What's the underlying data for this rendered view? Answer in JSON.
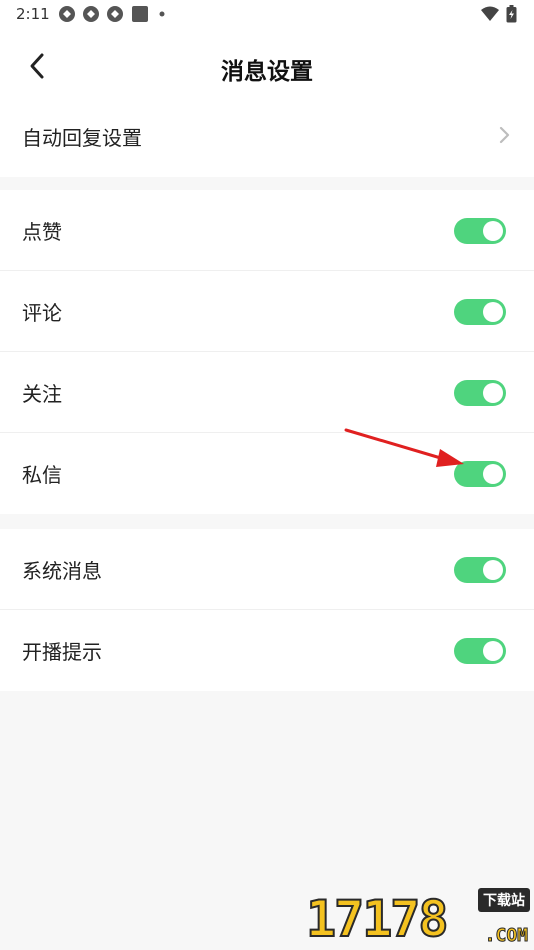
{
  "status_bar": {
    "time": "2:11",
    "left_icons": [
      "sync-icon",
      "sync-icon",
      "sync-icon",
      "square-icon",
      "dot-icon"
    ],
    "right_icons": [
      "wifi-icon",
      "battery-icon"
    ]
  },
  "header": {
    "title": "消息设置",
    "back_icon": "chevron-left-icon"
  },
  "sections": [
    {
      "rows": [
        {
          "label": "自动回复设置",
          "control": "chevron"
        }
      ]
    },
    {
      "rows": [
        {
          "label": "点赞",
          "control": "toggle",
          "on": true
        },
        {
          "label": "评论",
          "control": "toggle",
          "on": true
        },
        {
          "label": "关注",
          "control": "toggle",
          "on": true
        },
        {
          "label": "私信",
          "control": "toggle",
          "on": true
        }
      ]
    },
    {
      "rows": [
        {
          "label": "系统消息",
          "control": "toggle",
          "on": true
        },
        {
          "label": "开播提示",
          "control": "toggle",
          "on": true
        }
      ]
    }
  ],
  "colors": {
    "toggle_on": "#4fd47e",
    "annotation_arrow": "#e02020",
    "background": "#f7f7f7"
  },
  "watermark": {
    "number": "17178",
    "badge": "下载站",
    "suffix": ".COM"
  }
}
